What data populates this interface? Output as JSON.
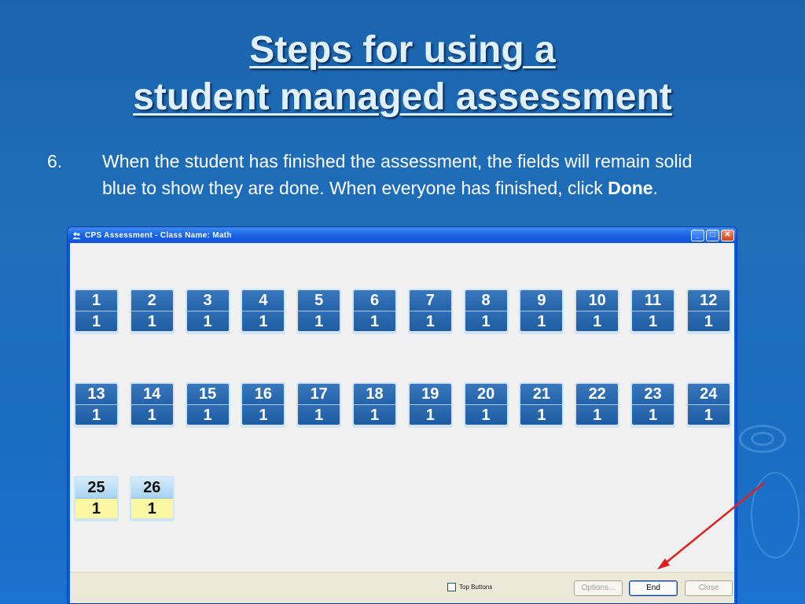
{
  "slide": {
    "title_line1": "Steps for using a",
    "title_line2": "student managed assessment",
    "step_number": "6.",
    "step_text_before": "When the student has finished the assessment, the fields will remain solid blue to show they are done.  When everyone has finished, click ",
    "step_text_bold": "Done",
    "step_text_after": "."
  },
  "window": {
    "title": "CPS Assessment - Class Name: Math",
    "minimize_glyph": "_",
    "maximize_glyph": "□",
    "close_glyph": "✕"
  },
  "tiles": [
    {
      "num": "1",
      "val": "1",
      "state": "done"
    },
    {
      "num": "2",
      "val": "1",
      "state": "done"
    },
    {
      "num": "3",
      "val": "1",
      "state": "done"
    },
    {
      "num": "4",
      "val": "1",
      "state": "done"
    },
    {
      "num": "5",
      "val": "1",
      "state": "done"
    },
    {
      "num": "6",
      "val": "1",
      "state": "done"
    },
    {
      "num": "7",
      "val": "1",
      "state": "done"
    },
    {
      "num": "8",
      "val": "1",
      "state": "done"
    },
    {
      "num": "9",
      "val": "1",
      "state": "done"
    },
    {
      "num": "10",
      "val": "1",
      "state": "done"
    },
    {
      "num": "11",
      "val": "1",
      "state": "done"
    },
    {
      "num": "12",
      "val": "1",
      "state": "done"
    },
    {
      "num": "13",
      "val": "1",
      "state": "done"
    },
    {
      "num": "14",
      "val": "1",
      "state": "done"
    },
    {
      "num": "15",
      "val": "1",
      "state": "done"
    },
    {
      "num": "16",
      "val": "1",
      "state": "done"
    },
    {
      "num": "17",
      "val": "1",
      "state": "done"
    },
    {
      "num": "18",
      "val": "1",
      "state": "done"
    },
    {
      "num": "19",
      "val": "1",
      "state": "done"
    },
    {
      "num": "20",
      "val": "1",
      "state": "done"
    },
    {
      "num": "21",
      "val": "1",
      "state": "done"
    },
    {
      "num": "22",
      "val": "1",
      "state": "done"
    },
    {
      "num": "23",
      "val": "1",
      "state": "done"
    },
    {
      "num": "24",
      "val": "1",
      "state": "done"
    },
    {
      "num": "25",
      "val": "1",
      "state": "pending"
    },
    {
      "num": "26",
      "val": "1",
      "state": "pending"
    }
  ],
  "bottom": {
    "top_buttons_label": "Top Buttons",
    "options_label": "Options...",
    "end_label": "End",
    "close_label": "Close"
  },
  "colors": {
    "done_tile": "#2463a9",
    "pending_tile_value": "#fbf7a3",
    "arrow": "#e02020"
  },
  "icons": {
    "app_icon": "users-icon",
    "annotation": "red-arrow-icon"
  }
}
